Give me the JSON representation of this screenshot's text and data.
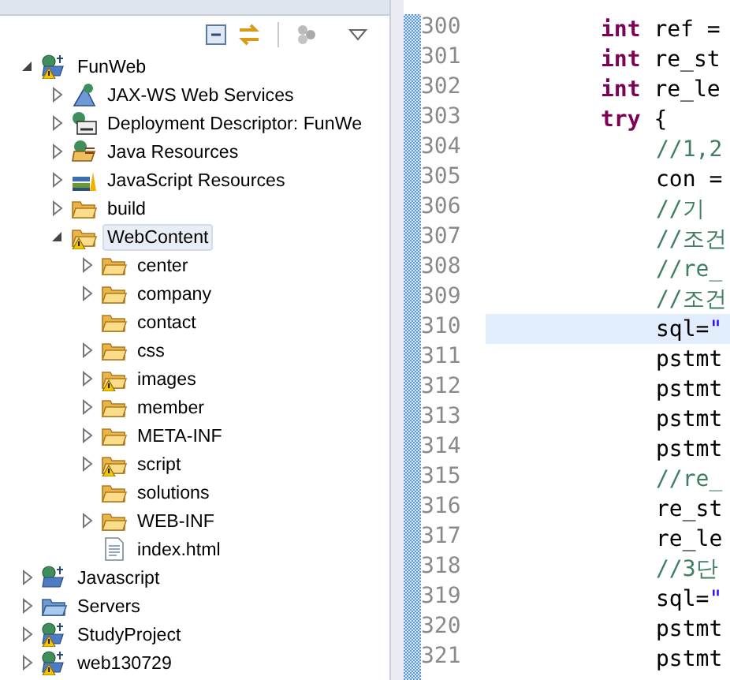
{
  "explorer": {
    "toolbar": [
      {
        "kind": "collapse"
      },
      {
        "kind": "link"
      },
      {
        "kind": "separator"
      },
      {
        "kind": "cluster"
      },
      {
        "kind": "menu"
      }
    ],
    "tree": [
      {
        "label": "FunWeb",
        "kind": "web-project",
        "warning": true,
        "has_children": true,
        "expanded": true,
        "selected": false,
        "children": [
          {
            "label": "JAX-WS Web Services",
            "kind": "services",
            "warning": false,
            "has_children": true,
            "expanded": false,
            "selected": false
          },
          {
            "label": "Deployment Descriptor: FunWe",
            "kind": "descriptor",
            "warning": false,
            "has_children": true,
            "expanded": false,
            "selected": false
          },
          {
            "label": "Java Resources",
            "kind": "java-resources",
            "warning": false,
            "has_children": true,
            "expanded": false,
            "selected": false
          },
          {
            "label": "JavaScript Resources",
            "kind": "js-resources",
            "warning": false,
            "has_children": true,
            "expanded": false,
            "selected": false
          },
          {
            "label": "build",
            "kind": "folder",
            "warning": false,
            "has_children": true,
            "expanded": false,
            "selected": false
          },
          {
            "label": "WebContent",
            "kind": "folder",
            "warning": true,
            "has_children": true,
            "expanded": true,
            "selected": true,
            "children": [
              {
                "label": "center",
                "kind": "folder",
                "warning": false,
                "has_children": true,
                "expanded": false,
                "selected": false
              },
              {
                "label": "company",
                "kind": "folder",
                "warning": false,
                "has_children": true,
                "expanded": false,
                "selected": false
              },
              {
                "label": "contact",
                "kind": "folder",
                "warning": false,
                "has_children": false,
                "expanded": false,
                "selected": false
              },
              {
                "label": "css",
                "kind": "folder",
                "warning": false,
                "has_children": true,
                "expanded": false,
                "selected": false
              },
              {
                "label": "images",
                "kind": "folder",
                "warning": true,
                "has_children": true,
                "expanded": false,
                "selected": false
              },
              {
                "label": "member",
                "kind": "folder",
                "warning": false,
                "has_children": true,
                "expanded": false,
                "selected": false
              },
              {
                "label": "META-INF",
                "kind": "folder",
                "warning": false,
                "has_children": true,
                "expanded": false,
                "selected": false
              },
              {
                "label": "script",
                "kind": "folder",
                "warning": true,
                "has_children": true,
                "expanded": false,
                "selected": false
              },
              {
                "label": "solutions",
                "kind": "folder",
                "warning": false,
                "has_children": false,
                "expanded": false,
                "selected": false
              },
              {
                "label": "WEB-INF",
                "kind": "folder",
                "warning": false,
                "has_children": true,
                "expanded": false,
                "selected": false
              },
              {
                "label": "index.html",
                "kind": "file",
                "warning": false,
                "has_children": false,
                "expanded": false,
                "selected": false
              }
            ]
          }
        ]
      },
      {
        "label": "Javascript",
        "kind": "js-project",
        "warning": false,
        "has_children": true,
        "expanded": false,
        "selected": false
      },
      {
        "label": "Servers",
        "kind": "servers",
        "warning": false,
        "has_children": true,
        "expanded": false,
        "selected": false
      },
      {
        "label": "StudyProject",
        "kind": "web-project",
        "warning": true,
        "has_children": true,
        "expanded": false,
        "selected": false
      },
      {
        "label": "web130729",
        "kind": "js-project",
        "warning": true,
        "has_children": true,
        "expanded": false,
        "selected": false
      }
    ]
  },
  "editor": {
    "lines": [
      {
        "number": "300",
        "current": false,
        "tokens": [
          {
            "kind": "keyword",
            "text": "int"
          },
          {
            "kind": "plain",
            "text": "ref ="
          }
        ]
      },
      {
        "number": "301",
        "current": false,
        "tokens": [
          {
            "kind": "keyword",
            "text": "int"
          },
          {
            "kind": "plain",
            "text": "re_st"
          }
        ]
      },
      {
        "number": "302",
        "current": false,
        "tokens": [
          {
            "kind": "keyword",
            "text": "int"
          },
          {
            "kind": "plain",
            "text": "re_le"
          }
        ]
      },
      {
        "number": "303",
        "current": false,
        "tokens": [
          {
            "kind": "keyword",
            "text": "try"
          },
          {
            "kind": "plain",
            "text": "{"
          }
        ],
        "children": [
          {
            "number": "304",
            "current": false,
            "tokens": [
              {
                "kind": "comment",
                "text": "//1,2"
              }
            ]
          },
          {
            "number": "305",
            "current": false,
            "tokens": [
              {
                "kind": "plain",
                "text": "con ="
              }
            ]
          },
          {
            "number": "306",
            "current": false,
            "tokens": [
              {
                "kind": "comment",
                "text": "//기"
              }
            ]
          },
          {
            "number": "307",
            "current": false,
            "tokens": [
              {
                "kind": "comment",
                "text": "//조건"
              }
            ]
          },
          {
            "number": "308",
            "current": false,
            "tokens": [
              {
                "kind": "comment",
                "text": "//re_"
              }
            ]
          },
          {
            "number": "309",
            "current": false,
            "tokens": [
              {
                "kind": "comment",
                "text": "//조건"
              }
            ]
          },
          {
            "number": "310",
            "current": true,
            "tokens": [
              {
                "kind": "plain",
                "text": "sql="
              },
              {
                "kind": "string",
                "text": "\""
              }
            ]
          },
          {
            "number": "311",
            "current": false,
            "tokens": [
              {
                "kind": "plain",
                "text": "pstmt"
              }
            ]
          },
          {
            "number": "312",
            "current": false,
            "tokens": [
              {
                "kind": "plain",
                "text": "pstmt"
              }
            ]
          },
          {
            "number": "313",
            "current": false,
            "tokens": [
              {
                "kind": "plain",
                "text": "pstmt"
              }
            ]
          },
          {
            "number": "314",
            "current": false,
            "tokens": [
              {
                "kind": "plain",
                "text": "pstmt"
              }
            ]
          },
          {
            "number": "315",
            "current": false,
            "tokens": [
              {
                "kind": "comment",
                "text": "//re_"
              }
            ]
          },
          {
            "number": "316",
            "current": false,
            "tokens": [
              {
                "kind": "plain",
                "text": "re_st"
              }
            ]
          },
          {
            "number": "317",
            "current": false,
            "tokens": [
              {
                "kind": "plain",
                "text": "re_le"
              }
            ]
          },
          {
            "number": "318",
            "current": false,
            "tokens": [
              {
                "kind": "comment",
                "text": "//3단"
              }
            ]
          },
          {
            "number": "319",
            "current": false,
            "tokens": [
              {
                "kind": "plain",
                "text": "sql="
              },
              {
                "kind": "string",
                "text": "\""
              }
            ]
          },
          {
            "number": "320",
            "current": false,
            "tokens": [
              {
                "kind": "plain",
                "text": "pstmt"
              }
            ]
          },
          {
            "number": "321",
            "current": false,
            "tokens": [
              {
                "kind": "plain",
                "text": "pstmt"
              }
            ]
          }
        ]
      }
    ]
  }
}
